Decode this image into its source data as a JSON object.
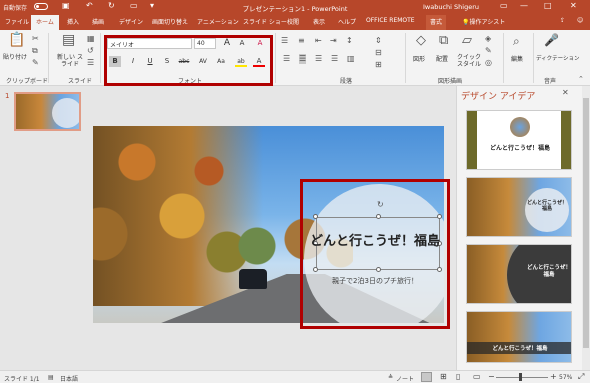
{
  "titlebar": {
    "autosave": "自動保存",
    "autosave_state": "オフ",
    "title": "プレゼンテーション1 - PowerPoint",
    "user": "Iwabuchi Shigeru",
    "qat_icons": [
      "save-icon",
      "undo-icon",
      "redo-icon",
      "slideshow-icon",
      "customize-icon"
    ],
    "window_buttons": [
      "ribbon-display-icon",
      "minimize-icon",
      "maximize-icon",
      "close-icon"
    ]
  },
  "tabs": [
    {
      "label": "ファイル"
    },
    {
      "label": "ホーム",
      "active": true
    },
    {
      "label": "挿入"
    },
    {
      "label": "描画"
    },
    {
      "label": "デザイン"
    },
    {
      "label": "画面切り替え"
    },
    {
      "label": "アニメーション"
    },
    {
      "label": "スライド ショー"
    },
    {
      "label": "校閲"
    },
    {
      "label": "表示"
    },
    {
      "label": "ヘルプ"
    },
    {
      "label": "OFFICE REMOTE"
    },
    {
      "label": "書式"
    },
    {
      "label": "操作アシスト"
    }
  ],
  "ribbon": {
    "clipboard": {
      "paste": "貼り付け",
      "label": "クリップボード"
    },
    "slides": {
      "new_slide": "新しい スライド",
      "label": "スライド"
    },
    "font": {
      "name": "メイリオ",
      "size": "40",
      "grow": "A",
      "shrink": "A",
      "clear": "A",
      "bold": "B",
      "italic": "I",
      "underline": "U",
      "shadow": "S",
      "strike": "abc",
      "spacing": "AV",
      "case": "Aa",
      "highlight": "ab",
      "color": "A",
      "label": "フォント"
    },
    "paragraph": {
      "label": "段落"
    },
    "drawing": {
      "shapes": "図形",
      "arrange": "配置",
      "quick_styles": "クイック スタイル",
      "label": "図形描画"
    },
    "editing": {
      "edit": "編集"
    },
    "voice": {
      "dictation": "ディクテーション",
      "label": "音声"
    }
  },
  "thumbnails": {
    "number": "1"
  },
  "slide": {
    "title": "どんと行こうぜ！福島",
    "subtitle": "親子で2泊3日のプチ旅行！"
  },
  "design_pane": {
    "title": "デザイン アイデア",
    "cards": [
      {
        "title": "どんと行こうぜ！福島"
      },
      {
        "title": "どんと行こうぜ！福島"
      },
      {
        "title": "どんと行こうぜ！福島"
      },
      {
        "title": "どんと行こうぜ！福島"
      }
    ]
  },
  "statusbar": {
    "slide": "スライド 1/1",
    "language": "日本語",
    "notes": "ノート",
    "zoom": "57%"
  }
}
